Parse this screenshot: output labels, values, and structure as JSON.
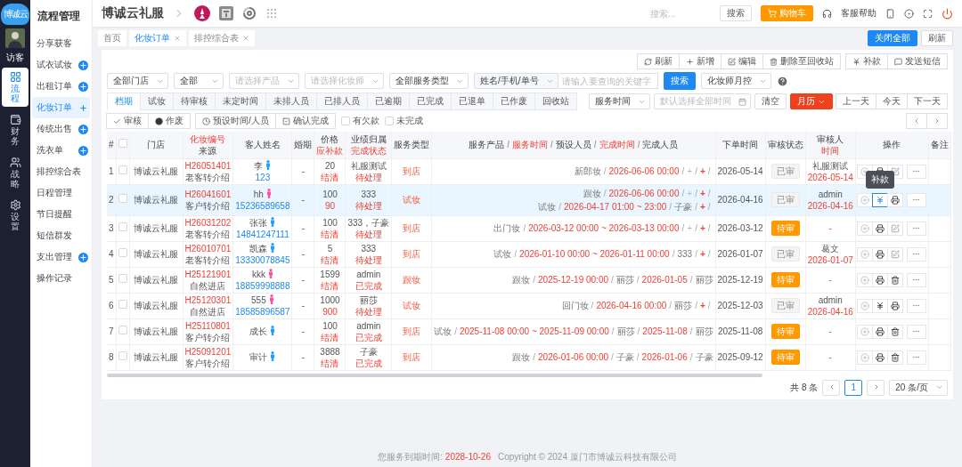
{
  "rail": {
    "logo": "博诚云",
    "user": "访客",
    "items": [
      {
        "label": "流程",
        "selected": true
      },
      {
        "label": "财务",
        "selected": false
      },
      {
        "label": "战略",
        "selected": false
      },
      {
        "label": "设置",
        "selected": false
      }
    ]
  },
  "sidebar": {
    "title": "流程管理",
    "items": [
      {
        "label": "分享获客",
        "has_add": false,
        "selected": false
      },
      {
        "label": "试衣试妆",
        "has_add": true,
        "selected": false
      },
      {
        "label": "出租订单",
        "has_add": true,
        "selected": false
      },
      {
        "label": "化妆订单",
        "has_add": true,
        "selected": true
      },
      {
        "label": "传统出售",
        "has_add": true,
        "selected": false
      },
      {
        "label": "洗衣单",
        "has_add": true,
        "selected": false
      },
      {
        "label": "排控综合表",
        "has_add": false,
        "selected": false
      },
      {
        "label": "日程管理",
        "has_add": false,
        "selected": false
      },
      {
        "label": "节日提醒",
        "has_add": false,
        "selected": false
      },
      {
        "label": "短信群发",
        "has_add": false,
        "selected": false
      },
      {
        "label": "支出管理",
        "has_add": true,
        "selected": false
      },
      {
        "label": "操作记录",
        "has_add": false,
        "selected": false
      }
    ]
  },
  "header": {
    "brand": "博诚云礼服",
    "search_placeholder": "搜索...",
    "search_button": "搜索",
    "cart": "购物车",
    "help": "客服帮助"
  },
  "page_tabs": [
    {
      "label": "首页",
      "closable": false,
      "selected": false
    },
    {
      "label": "化妆订单",
      "closable": true,
      "selected": true
    },
    {
      "label": "排控综合表",
      "closable": true,
      "selected": false
    }
  ],
  "close_all": "关闭全部",
  "refresh": "刷新",
  "toolbar": [
    [
      {
        "label": "刷新"
      },
      {
        "label": "新增"
      },
      {
        "label": "编辑"
      },
      {
        "label": "删除至回收站"
      }
    ],
    [
      {
        "label": "补款"
      },
      {
        "label": "发送短信"
      }
    ]
  ],
  "filters": [
    {
      "kind": "select",
      "value": "全部门店"
    },
    {
      "kind": "select",
      "value": "全部"
    },
    {
      "kind": "select",
      "placeholder": "请选择产品"
    },
    {
      "kind": "select",
      "placeholder": "请选择化妆师"
    },
    {
      "kind": "select",
      "value": "全部服务类型"
    },
    {
      "kind": "search",
      "value": "姓名/手机/单号",
      "placeholder": "请输入要查询的关键字"
    }
  ],
  "search_button": "搜索",
  "month_control": "化妆师月控",
  "status_tabs": [
    {
      "label": "档期",
      "selected": true
    },
    {
      "label": "试妆",
      "selected": false
    },
    {
      "label": "待审核",
      "selected": false
    },
    {
      "label": "未定时间",
      "selected": false
    },
    {
      "label": "未排人员",
      "selected": false
    },
    {
      "label": "已排人员",
      "selected": false
    },
    {
      "label": "已逾期",
      "selected": false
    },
    {
      "label": "已完成",
      "selected": false
    },
    {
      "label": "已退单",
      "selected": false
    },
    {
      "label": "已作废",
      "selected": false
    },
    {
      "label": "回收站",
      "selected": false
    }
  ],
  "date_filter": {
    "mode": "服务时间",
    "placeholder": "默认选择全部时间",
    "clear": "清空",
    "calendar": "月历",
    "nav": [
      "上一天",
      "今天",
      "下一天"
    ]
  },
  "actions": [
    {
      "kind": "button",
      "label": "审核"
    },
    {
      "kind": "button",
      "label": "作废"
    },
    {
      "kind": "button",
      "label": "预设时间/人员"
    },
    {
      "kind": "button",
      "label": "确认完成"
    },
    {
      "kind": "checkbox",
      "label": "有欠款",
      "checked": false
    },
    {
      "kind": "checkbox",
      "label": "未完成",
      "checked": false
    }
  ],
  "table": {
    "separator": "/",
    "headers": [
      {
        "kind": "text",
        "lines": [
          [
            {
              "t": "#",
              "red": false
            }
          ]
        ]
      },
      {
        "kind": "checkbox",
        "checked": false
      },
      {
        "kind": "text",
        "lines": [
          [
            {
              "t": "门店",
              "red": false
            }
          ]
        ]
      },
      {
        "kind": "text",
        "lines": [
          [
            {
              "t": "化妆编号",
              "red": true
            }
          ],
          [
            {
              "t": "来源",
              "red": false
            }
          ]
        ]
      },
      {
        "kind": "text",
        "lines": [
          [
            {
              "t": "客人姓名",
              "red": false
            }
          ]
        ]
      },
      {
        "kind": "text",
        "lines": [
          [
            {
              "t": "婚期",
              "red": false
            }
          ]
        ]
      },
      {
        "kind": "text",
        "lines": [
          [
            {
              "t": "价格",
              "red": false
            }
          ],
          [
            {
              "t": "应补款",
              "red": true
            }
          ]
        ]
      },
      {
        "kind": "text",
        "lines": [
          [
            {
              "t": "业绩归属",
              "red": false
            }
          ],
          [
            {
              "t": "完成状态",
              "red": true
            }
          ]
        ]
      },
      {
        "kind": "text",
        "lines": [
          [
            {
              "t": "服务类型",
              "red": false
            }
          ]
        ]
      },
      {
        "kind": "text",
        "lines": [
          [
            {
              "t": "服务产品",
              "red": false
            },
            {
              "t": "服务时间",
              "red": true
            },
            {
              "t": "预设人员",
              "red": false
            },
            {
              "t": "完成时间",
              "red": true
            },
            {
              "t": "完成人员",
              "red": false
            }
          ]
        ]
      },
      {
        "kind": "text",
        "lines": [
          [
            {
              "t": "下单时间",
              "red": false
            }
          ]
        ]
      },
      {
        "kind": "text",
        "lines": [
          [
            {
              "t": "审核状态",
              "red": false
            }
          ]
        ]
      },
      {
        "kind": "text",
        "lines": [
          [
            {
              "t": "审核人",
              "red": false
            }
          ],
          [
            {
              "t": "时间",
              "red": true
            }
          ]
        ]
      },
      {
        "kind": "text",
        "lines": [
          [
            {
              "t": "操作",
              "red": false
            }
          ]
        ]
      },
      {
        "kind": "text",
        "lines": [
          [
            {
              "t": "备注",
              "red": false
            }
          ]
        ]
      }
    ],
    "rows": [
      {
        "index": "1",
        "checked": false,
        "selected": false,
        "store": "博诚云礼服",
        "order_no": "H26051401",
        "source": "老客转介绍",
        "name": "李",
        "color": "#1ea0ff",
        "phone": "123",
        "wedding": "-",
        "price": "20",
        "due": "结清",
        "owner": "礼服测试",
        "completion": "待处理",
        "service_type": "到店",
        "service": [
          {
            "trailing": true,
            "parts": [
              {
                "t": "新郎妆",
                "kind": "name"
              },
              {
                "t": "2026-06-06 00:00",
                "kind": "time"
              },
              {
                "t": "+",
                "kind": "add"
              },
              {
                "t": "+",
                "kind": "add_red"
              }
            ]
          }
        ],
        "order_date": "2026-05-14",
        "review": {
          "text": "已审",
          "approved": true
        },
        "reviewer": "礼服测试",
        "review_time": "2026-05-14",
        "ops": [
          {
            "kind": "add",
            "active": false
          },
          {
            "kind": "print",
            "active": false
          },
          {
            "kind": "edit",
            "active": false
          },
          {
            "kind": "more",
            "active": false
          }
        ]
      },
      {
        "index": "2",
        "checked": false,
        "selected": true,
        "store": "博诚云礼服",
        "order_no": "H26041601",
        "source": "客户转介绍",
        "name": "hh",
        "color": "#ff4fa3",
        "phone": "15236589658",
        "wedding": "-",
        "price": "100",
        "due": "90",
        "owner": "333",
        "completion": "待处理",
        "service_type": "试妆",
        "service": [
          {
            "trailing": true,
            "parts": [
              {
                "t": "跟妆",
                "kind": "name"
              },
              {
                "t": "2026-06-06 00:00",
                "kind": "time"
              },
              {
                "t": "+",
                "kind": "add"
              },
              {
                "t": "+",
                "kind": "add_red"
              }
            ]
          },
          {
            "trailing": true,
            "parts": [
              {
                "t": "试妆",
                "kind": "name"
              },
              {
                "t": "2026-04-17 01:00 ~ 23:00",
                "kind": "time"
              },
              {
                "t": "子豪",
                "kind": "person"
              },
              {
                "t": "+",
                "kind": "add_red"
              }
            ]
          }
        ],
        "order_date": "2026-04-16",
        "review": {
          "text": "已审",
          "approved": true
        },
        "reviewer": "admin",
        "review_time": "2026-04-16",
        "ops": [
          {
            "kind": "add",
            "active": false
          },
          {
            "kind": "yen",
            "active": true,
            "tooltip": "补款"
          },
          {
            "kind": "print",
            "active": false
          },
          {
            "kind": "more",
            "active": false
          }
        ]
      },
      {
        "index": "3",
        "checked": false,
        "selected": false,
        "store": "博诚云礼服",
        "order_no": "H26031202",
        "source": "老客转介绍",
        "name": "张张",
        "color": "#1ea0ff",
        "phone": "14841247111",
        "wedding": "-",
        "price": "100",
        "due": "结清",
        "owner": "333，子豪",
        "completion": "待处理",
        "service_type": "到店",
        "service": [
          {
            "trailing": true,
            "parts": [
              {
                "t": "出门妆",
                "kind": "name"
              },
              {
                "t": "2026-03-12 00:00 ~ 2026-03-13 00:00",
                "kind": "time"
              },
              {
                "t": "+",
                "kind": "add"
              },
              {
                "t": "+",
                "kind": "add_red"
              }
            ]
          }
        ],
        "order_date": "2026-03-12",
        "review": {
          "text": "待审",
          "approved": false
        },
        "reviewer": "-",
        "ops": [
          {
            "kind": "add",
            "active": false
          },
          {
            "kind": "print",
            "active": false
          },
          {
            "kind": "edit",
            "active": false
          },
          {
            "kind": "more",
            "active": false
          }
        ]
      },
      {
        "index": "4",
        "checked": false,
        "selected": false,
        "store": "博诚云礼服",
        "order_no": "H26010701",
        "source": "老客转介绍",
        "name": "凯森",
        "color": "#1ea0ff",
        "phone": "13330078845",
        "wedding": "-",
        "price": "5",
        "due": "结清",
        "owner": "333",
        "completion": "待处理",
        "service_type": "到店",
        "service": [
          {
            "trailing": true,
            "parts": [
              {
                "t": "试妆",
                "kind": "name"
              },
              {
                "t": "2026-01-10 00:00 ~ 2026-01-11 00:00",
                "kind": "time"
              },
              {
                "t": "333",
                "kind": "person"
              },
              {
                "t": "+",
                "kind": "add_red"
              }
            ]
          }
        ],
        "order_date": "2026-01-07",
        "review": {
          "text": "已审",
          "approved": true
        },
        "reviewer": "葛文",
        "review_time": "2026-01-07",
        "ops": [
          {
            "kind": "add",
            "active": false
          },
          {
            "kind": "print",
            "active": false
          },
          {
            "kind": "edit",
            "active": false
          },
          {
            "kind": "more",
            "active": false
          }
        ]
      },
      {
        "index": "5",
        "checked": false,
        "selected": false,
        "store": "博诚云礼服",
        "order_no": "H25121901",
        "source": "自然进店",
        "name": "kkk",
        "color": "#ff4fa3",
        "phone": "18859998888",
        "wedding": "-",
        "price": "1599",
        "due": "结清",
        "owner": "admin",
        "completion": "已完成",
        "service_type": "跟妆",
        "service": [
          {
            "trailing": false,
            "parts": [
              {
                "t": "跟妆",
                "kind": "name"
              },
              {
                "t": "2025-12-19 00:00",
                "kind": "time"
              },
              {
                "t": "丽莎",
                "kind": "person"
              },
              {
                "t": "2026-01-05",
                "kind": "time"
              },
              {
                "t": "丽莎",
                "kind": "person"
              }
            ]
          }
        ],
        "order_date": "2025-12-19",
        "review": {
          "text": "待审",
          "approved": false
        },
        "reviewer": "-",
        "ops": [
          {
            "kind": "add",
            "active": false
          },
          {
            "kind": "print",
            "active": false
          },
          {
            "kind": "delete",
            "active": false
          },
          {
            "kind": "more",
            "active": false
          }
        ]
      },
      {
        "index": "6",
        "checked": false,
        "selected": false,
        "store": "博诚云礼服",
        "order_no": "H25120301",
        "source": "自然进店",
        "name": "555",
        "color": "#ff4fa3",
        "phone": "18585896587",
        "wedding": "-",
        "price": "1000",
        "due": "900",
        "owner": "丽莎",
        "completion": "待处理",
        "service_type": "试妆",
        "service": [
          {
            "trailing": true,
            "parts": [
              {
                "t": "回门妆",
                "kind": "name"
              },
              {
                "t": "2026-04-16 00:00",
                "kind": "time"
              },
              {
                "t": "丽莎",
                "kind": "person"
              },
              {
                "t": "+",
                "kind": "add_red"
              }
            ]
          }
        ],
        "order_date": "2025-12-03",
        "review": {
          "text": "已审",
          "approved": true
        },
        "reviewer": "admin",
        "review_time": "2026-04-16",
        "ops": [
          {
            "kind": "add",
            "active": false
          },
          {
            "kind": "yen",
            "active": false
          },
          {
            "kind": "print",
            "active": false
          },
          {
            "kind": "more",
            "active": false
          }
        ]
      },
      {
        "index": "7",
        "checked": false,
        "selected": false,
        "store": "博诚云礼服",
        "order_no": "H25110801",
        "source": "客户转介绍",
        "name": "成长",
        "color": "#1ea0ff",
        "wedding": "-",
        "price": "100",
        "due": "结清",
        "owner": "admin",
        "completion": "已完成",
        "service_type": "到店",
        "service": [
          {
            "trailing": false,
            "parts": [
              {
                "t": "试妆",
                "kind": "name"
              },
              {
                "t": "2025-11-08 00:00 ~ 2025-11-09 00:00",
                "kind": "time"
              },
              {
                "t": "丽莎",
                "kind": "person"
              },
              {
                "t": "2025-11-08",
                "kind": "time"
              },
              {
                "t": "丽莎",
                "kind": "person"
              }
            ]
          }
        ],
        "order_date": "2025-11-08",
        "review": {
          "text": "待审",
          "approved": false
        },
        "reviewer": "-",
        "ops": [
          {
            "kind": "add",
            "active": false
          },
          {
            "kind": "print",
            "active": false
          },
          {
            "kind": "delete",
            "active": false
          },
          {
            "kind": "more",
            "active": false
          }
        ]
      },
      {
        "index": "8",
        "checked": false,
        "selected": false,
        "store": "博诚云礼服",
        "order_no": "H25091201",
        "source": "客户转介绍",
        "name": "审计",
        "color": "#1ea0ff",
        "wedding": "-",
        "price": "3888",
        "due": "结清",
        "owner": "子豪",
        "completion": "已完成",
        "service_type": "到店",
        "service": [
          {
            "trailing": false,
            "parts": [
              {
                "t": "跟妆",
                "kind": "name"
              },
              {
                "t": "2026-01-06 00:00",
                "kind": "time"
              },
              {
                "t": "子豪",
                "kind": "person"
              },
              {
                "t": "2026-01-06",
                "kind": "time"
              },
              {
                "t": "子豪",
                "kind": "person"
              }
            ]
          }
        ],
        "order_date": "2025-09-12",
        "review": {
          "text": "待审",
          "approved": false
        },
        "reviewer": "-",
        "ops": [
          {
            "kind": "add",
            "active": false
          },
          {
            "kind": "print",
            "active": false
          },
          {
            "kind": "delete",
            "active": false
          },
          {
            "kind": "more",
            "active": false
          }
        ]
      }
    ]
  },
  "pagination": {
    "total": "共 8 条",
    "pages": [
      {
        "label": "1",
        "selected": true
      }
    ],
    "page_size": "20 条/页"
  },
  "footer": {
    "expiry_label": "您服务到期时间:",
    "expiry_date": "2028-10-26",
    "copyright": "Copyright © 2024 厦门市博诚云科技有限公司"
  }
}
